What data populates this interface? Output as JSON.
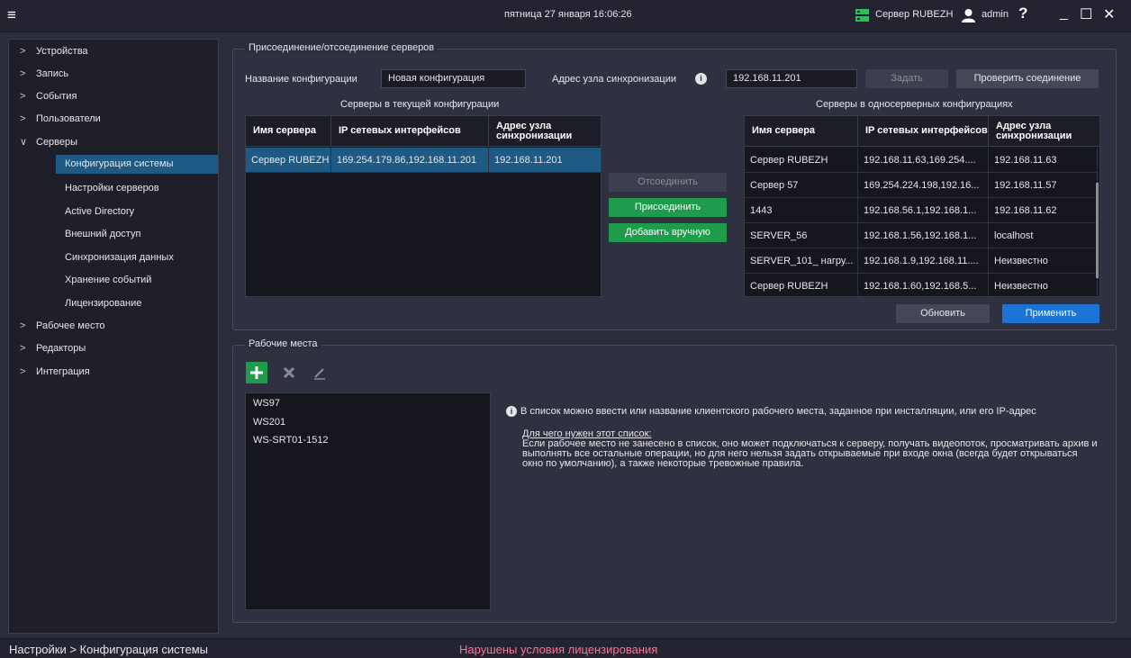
{
  "titlebar": {
    "datetime": "пятница 27 января 16:06:26",
    "server_label": "Сервер RUBEZH",
    "user_label": "admin",
    "help": "?",
    "minimize": "_",
    "maximize": "☐",
    "close": "✕"
  },
  "sidebar": {
    "items": [
      {
        "label": "Устройства",
        "chevron": ">"
      },
      {
        "label": "Запись",
        "chevron": ">"
      },
      {
        "label": "События",
        "chevron": ">"
      },
      {
        "label": "Пользователи",
        "chevron": ">"
      },
      {
        "label": "Серверы",
        "chevron": "∨"
      },
      {
        "label": "Рабочее место",
        "chevron": ">"
      },
      {
        "label": "Редакторы",
        "chevron": ">"
      },
      {
        "label": "Интеграция",
        "chevron": ">"
      }
    ],
    "subitems": [
      "Конфигурация системы",
      "Настройки серверов",
      "Active Directory",
      "Внешний доступ",
      "Синхронизация данных",
      "Хранение событий",
      "Лицензирование"
    ]
  },
  "servers_panel": {
    "legend": "Присоединение/отсоединение серверов",
    "config_name_label": "Название конфигурации",
    "config_name_value": "Новая конфигурация",
    "sync_address_label": "Адрес узла синхронизации",
    "sync_address_value": "192.168.11.201",
    "set_button": "Задать",
    "check_button": "Проверить соединение",
    "current_title": "Серверы в текущей конфигурации",
    "single_title": "Серверы в односерверных конфигурациях",
    "current_headers": [
      "Имя сервера",
      "IP сетевых интерфейсов",
      "Адрес узла синхронизации"
    ],
    "current_rows": [
      [
        "Сервер RUBEZH",
        "169.254.179.86,192.168.11.201",
        "192.168.11.201"
      ]
    ],
    "single_headers": [
      "Имя сервера",
      "IP сетевых интерфейсов",
      "Адрес узла синхронизации"
    ],
    "single_rows": [
      [
        "Сервер RUBEZH",
        "192.168.11.63,169.254....",
        "192.168.11.63"
      ],
      [
        "Сервер 57",
        "169.254.224.198,192.16...",
        "192.168.11.57"
      ],
      [
        "1443",
        "192.168.56.1,192.168.1...",
        "192.168.11.62"
      ],
      [
        "SERVER_56",
        "192.168.1.56,192.168.1...",
        "localhost"
      ],
      [
        "SERVER_101_ нагру...",
        "192.168.1.9,192.168.11....",
        "Неизвестно"
      ],
      [
        "Сервер RUBEZH",
        "192.168.1.60,192.168.5...",
        "Неизвестно"
      ]
    ],
    "disconnect_button": "Отсоединить",
    "connect_button": "Присоединить",
    "add_manual_button": "Добавить вручную",
    "refresh_button": "Обновить",
    "apply_button": "Применить"
  },
  "workplaces": {
    "legend": "Рабочие места",
    "items": [
      "WS97",
      "WS201",
      "WS-SRT01-1512"
    ],
    "info": "В список можно ввести или название клиентского рабочего места, заданное при инсталляции, или его IP-адрес",
    "help_title": "Для чего нужен этот список:",
    "help_body": "Если рабочее место не занесено в список, оно может подключаться к серверу, получать видеопоток, просматривать архив и выполнять все остальные операции, но для него нельзя задать открываемые при входе окна (всегда будет открываться окно по умолчанию), а также некоторые тревожные правила."
  },
  "statusbar": {
    "breadcrumb": "Настройки  >  Конфигурация системы",
    "warning": "Нарушены условия лицензирования"
  },
  "colors": {
    "accent_selected": "#1f5a85",
    "green_button": "#1e9c4b",
    "blue_button": "#1b73d4",
    "warning_text": "#ff6f9a"
  }
}
